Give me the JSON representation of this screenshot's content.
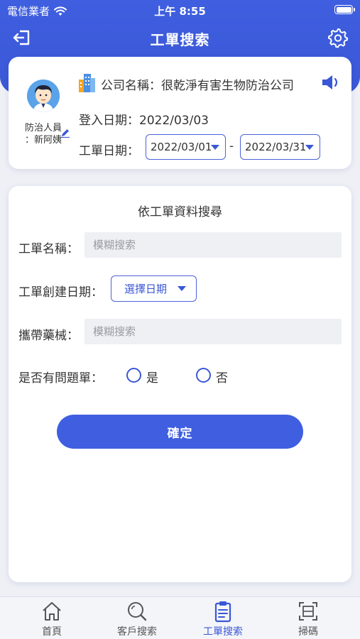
{
  "status_bar": {
    "carrier": "電信業者",
    "time": "上午 8:55",
    "icons": [
      "wifi-icon",
      "battery-icon"
    ]
  },
  "nav": {
    "title": "工單搜索",
    "icons": [
      "logout-icon",
      "gear-icon"
    ]
  },
  "info": {
    "person_label_line1": "防治人員",
    "person_label_line2": "：新阿姨",
    "company_label": "公司名稱：",
    "company_name": "很乾淨有害生物防治公司",
    "login_label": "登入日期：",
    "login_date": "2022/03/03",
    "work_order_date_label": "工單日期：",
    "date_start": "2022/03/01",
    "date_separator": "-",
    "date_end": "2022/03/31"
  },
  "search": {
    "title": "依工單資料搜尋",
    "name_label": "工單名稱：",
    "name_placeholder": "模糊搜索",
    "created_date_label": "工單創建日期：",
    "select_date_label": "選擇日期",
    "equipment_label": "攜帶藥械：",
    "equipment_placeholder": "模糊搜索",
    "problem_label": "是否有問題單：",
    "option_yes": "是",
    "option_no": "否",
    "confirm_label": "確定"
  },
  "tabs": [
    {
      "label": "首頁",
      "icon": "home-icon"
    },
    {
      "label": "客戶搜索",
      "icon": "search-icon"
    },
    {
      "label": "工單搜索",
      "icon": "clipboard-icon",
      "active": true
    },
    {
      "label": "掃碼",
      "icon": "scan-icon"
    }
  ],
  "colors": {
    "primary": "#3f5fe0",
    "background": "#eef0f6",
    "input_bg": "#eef0f4"
  }
}
